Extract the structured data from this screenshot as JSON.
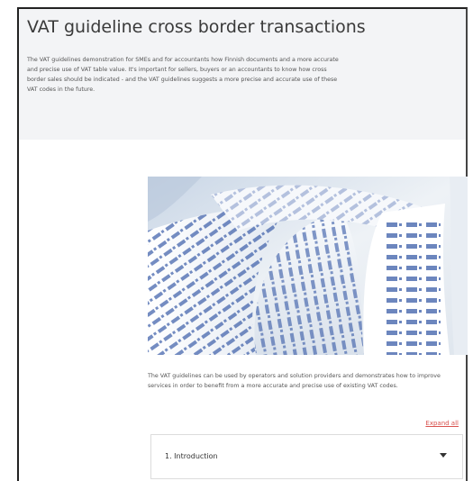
{
  "header": {
    "title": "VAT guideline cross border transactions",
    "intro": "The VAT guidelines demonstration for SMEs and for accountants how Finnish documents and a more accurate and precise use of VAT table value. It's important for sellers, buyers or an accountants to know how cross border sales should be indicated - and the VAT guidelines suggests a more precise and accurate use of these VAT codes in the future."
  },
  "hero_image": {
    "subject": "receipt-paper-rolls-with-printed-numbers"
  },
  "content": {
    "description": "The VAT guidelines can be used by operators and solution providers and demonstrates how to improve services in order to benefit from a more accurate and precise use of existing VAT codes.",
    "expand_link": "Expand all"
  },
  "accordion": {
    "items": [
      {
        "label": "1. Introduction"
      }
    ]
  },
  "colors": {
    "header_bg": "#f3f4f6",
    "link": "#d9534f",
    "text": "#333333"
  }
}
